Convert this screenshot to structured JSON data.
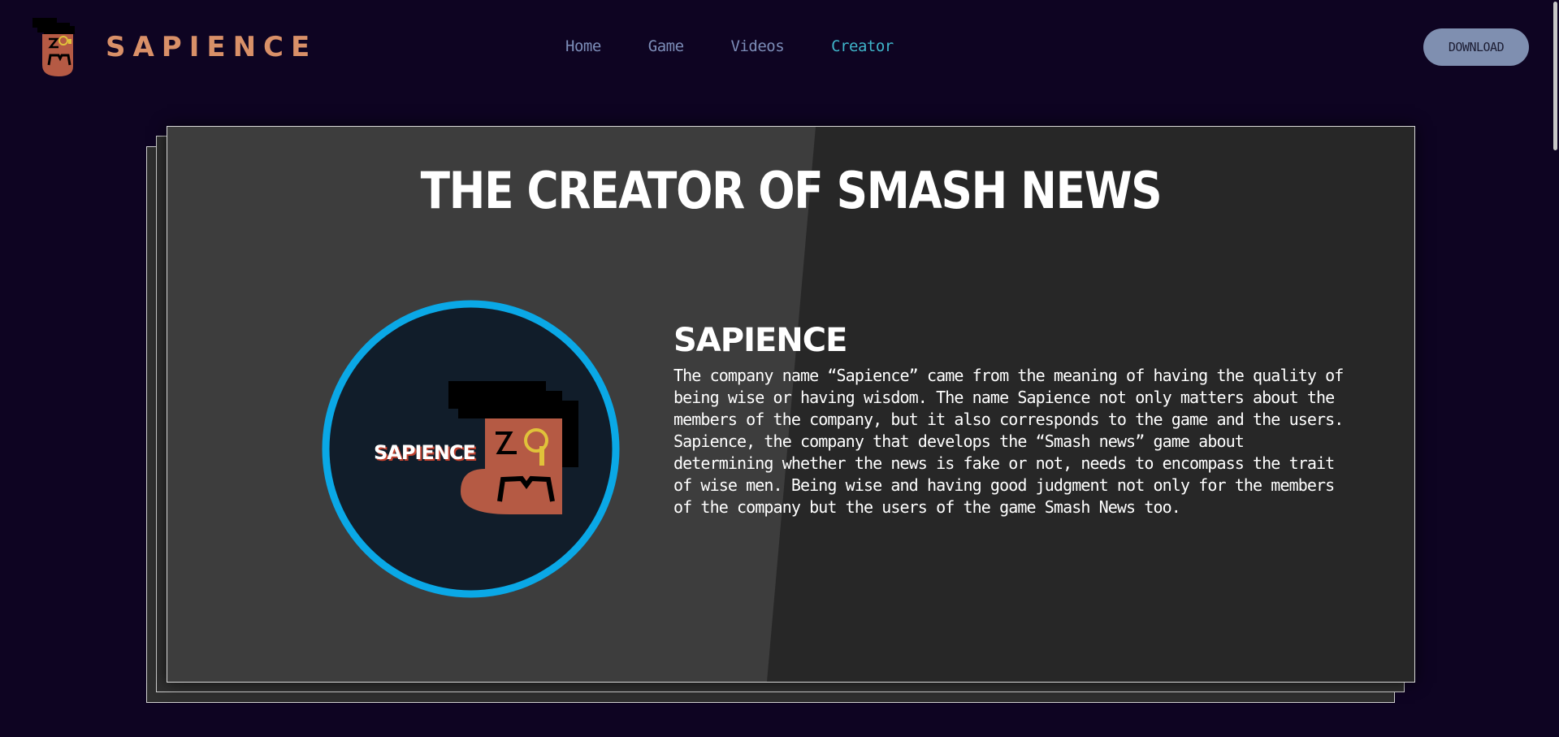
{
  "header": {
    "brand_name": "SAPIENCE",
    "logo_icon": "sapience-mascot-icon",
    "nav": [
      {
        "label": "Home",
        "active": false
      },
      {
        "label": "Game",
        "active": false
      },
      {
        "label": "Videos",
        "active": false
      },
      {
        "label": "Creator",
        "active": true
      }
    ],
    "download_label": "DOWNLOAD"
  },
  "main": {
    "title": "THE CREATOR OF SMASH NEWS",
    "creator": {
      "name": "SAPIENCE",
      "avatar_text": "SAPIENCE",
      "description": "The company name “Sapience” came from the meaning of having the quality of being wise or having wisdom. The name Sapience not only matters about the members of the company, but it also corresponds to the game and the users. Sapience, the company that develops the “Smash news” game about determining whether the news is fake or not, needs to encompass the trait of wise men. Being wise and having good judgment not only for the members of the company but the users of the game Smash News too."
    }
  },
  "colors": {
    "background": "#0e0422",
    "brand": "#d99068",
    "nav": "#7c8db8",
    "nav_active": "#3fb4c9",
    "button": "#7f8fb0",
    "avatar_ring": "#0aa8e6"
  }
}
